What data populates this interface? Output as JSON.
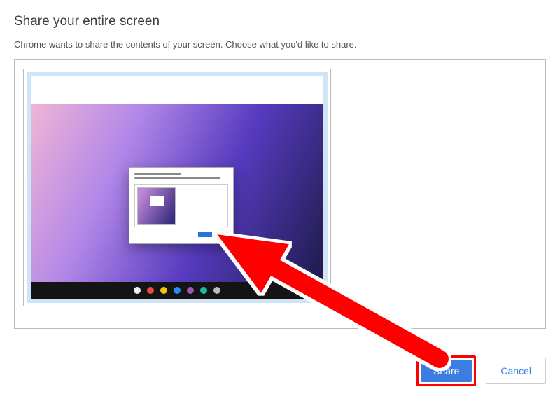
{
  "dialog": {
    "title": "Share your entire screen",
    "subtitle": "Chrome wants to share the contents of your screen. Choose what you'd like to share."
  },
  "buttons": {
    "share": "Share",
    "cancel": "Cancel"
  },
  "taskbar_icons": [
    "#eeeeee",
    "#e84d3c",
    "#f1c40f",
    "#2d89ef",
    "#9b59b6",
    "#1abc9c",
    "#bbbbbb"
  ]
}
